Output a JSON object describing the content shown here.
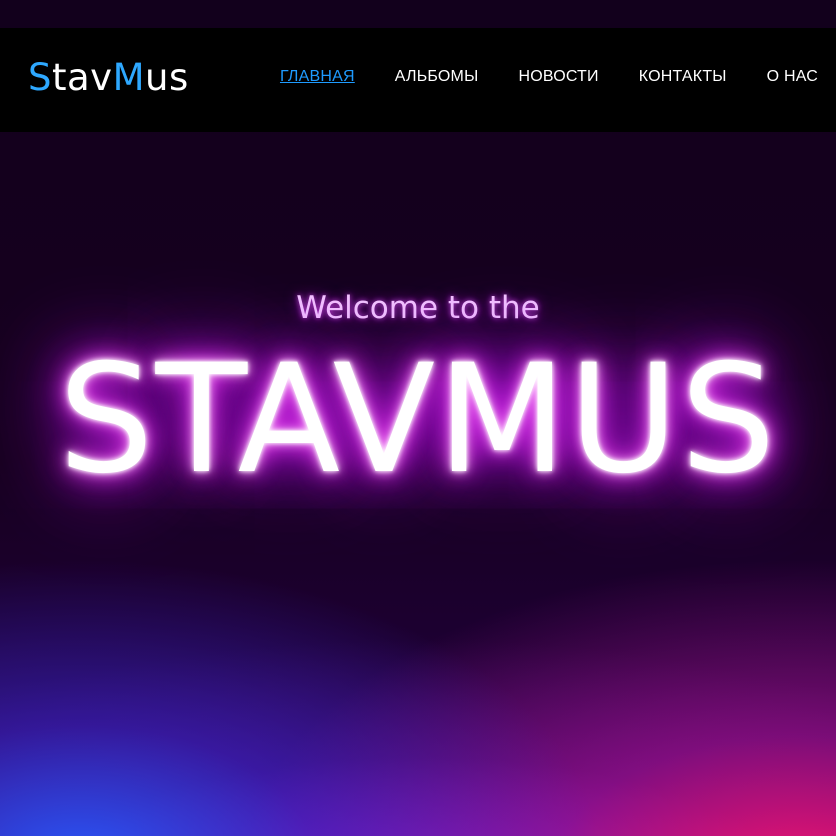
{
  "header": {
    "logo": {
      "s": "S",
      "tav": "tav",
      "m": "M",
      "us": "us"
    },
    "nav": [
      {
        "label": "ГЛАВНАЯ",
        "active": true
      },
      {
        "label": "АЛЬБОМЫ",
        "active": false
      },
      {
        "label": "НОВОСТИ",
        "active": false
      },
      {
        "label": "КОНТАКТЫ",
        "active": false
      },
      {
        "label": "О НАС",
        "active": false
      }
    ]
  },
  "hero": {
    "welcome": "Welcome to the",
    "title": "STAVMUS"
  },
  "colors": {
    "accent": "#1e9bff",
    "nav_bg": "#000000",
    "glow": "#e020ff",
    "gradient_blue": "#285aff",
    "gradient_pink": "#ff146e"
  }
}
